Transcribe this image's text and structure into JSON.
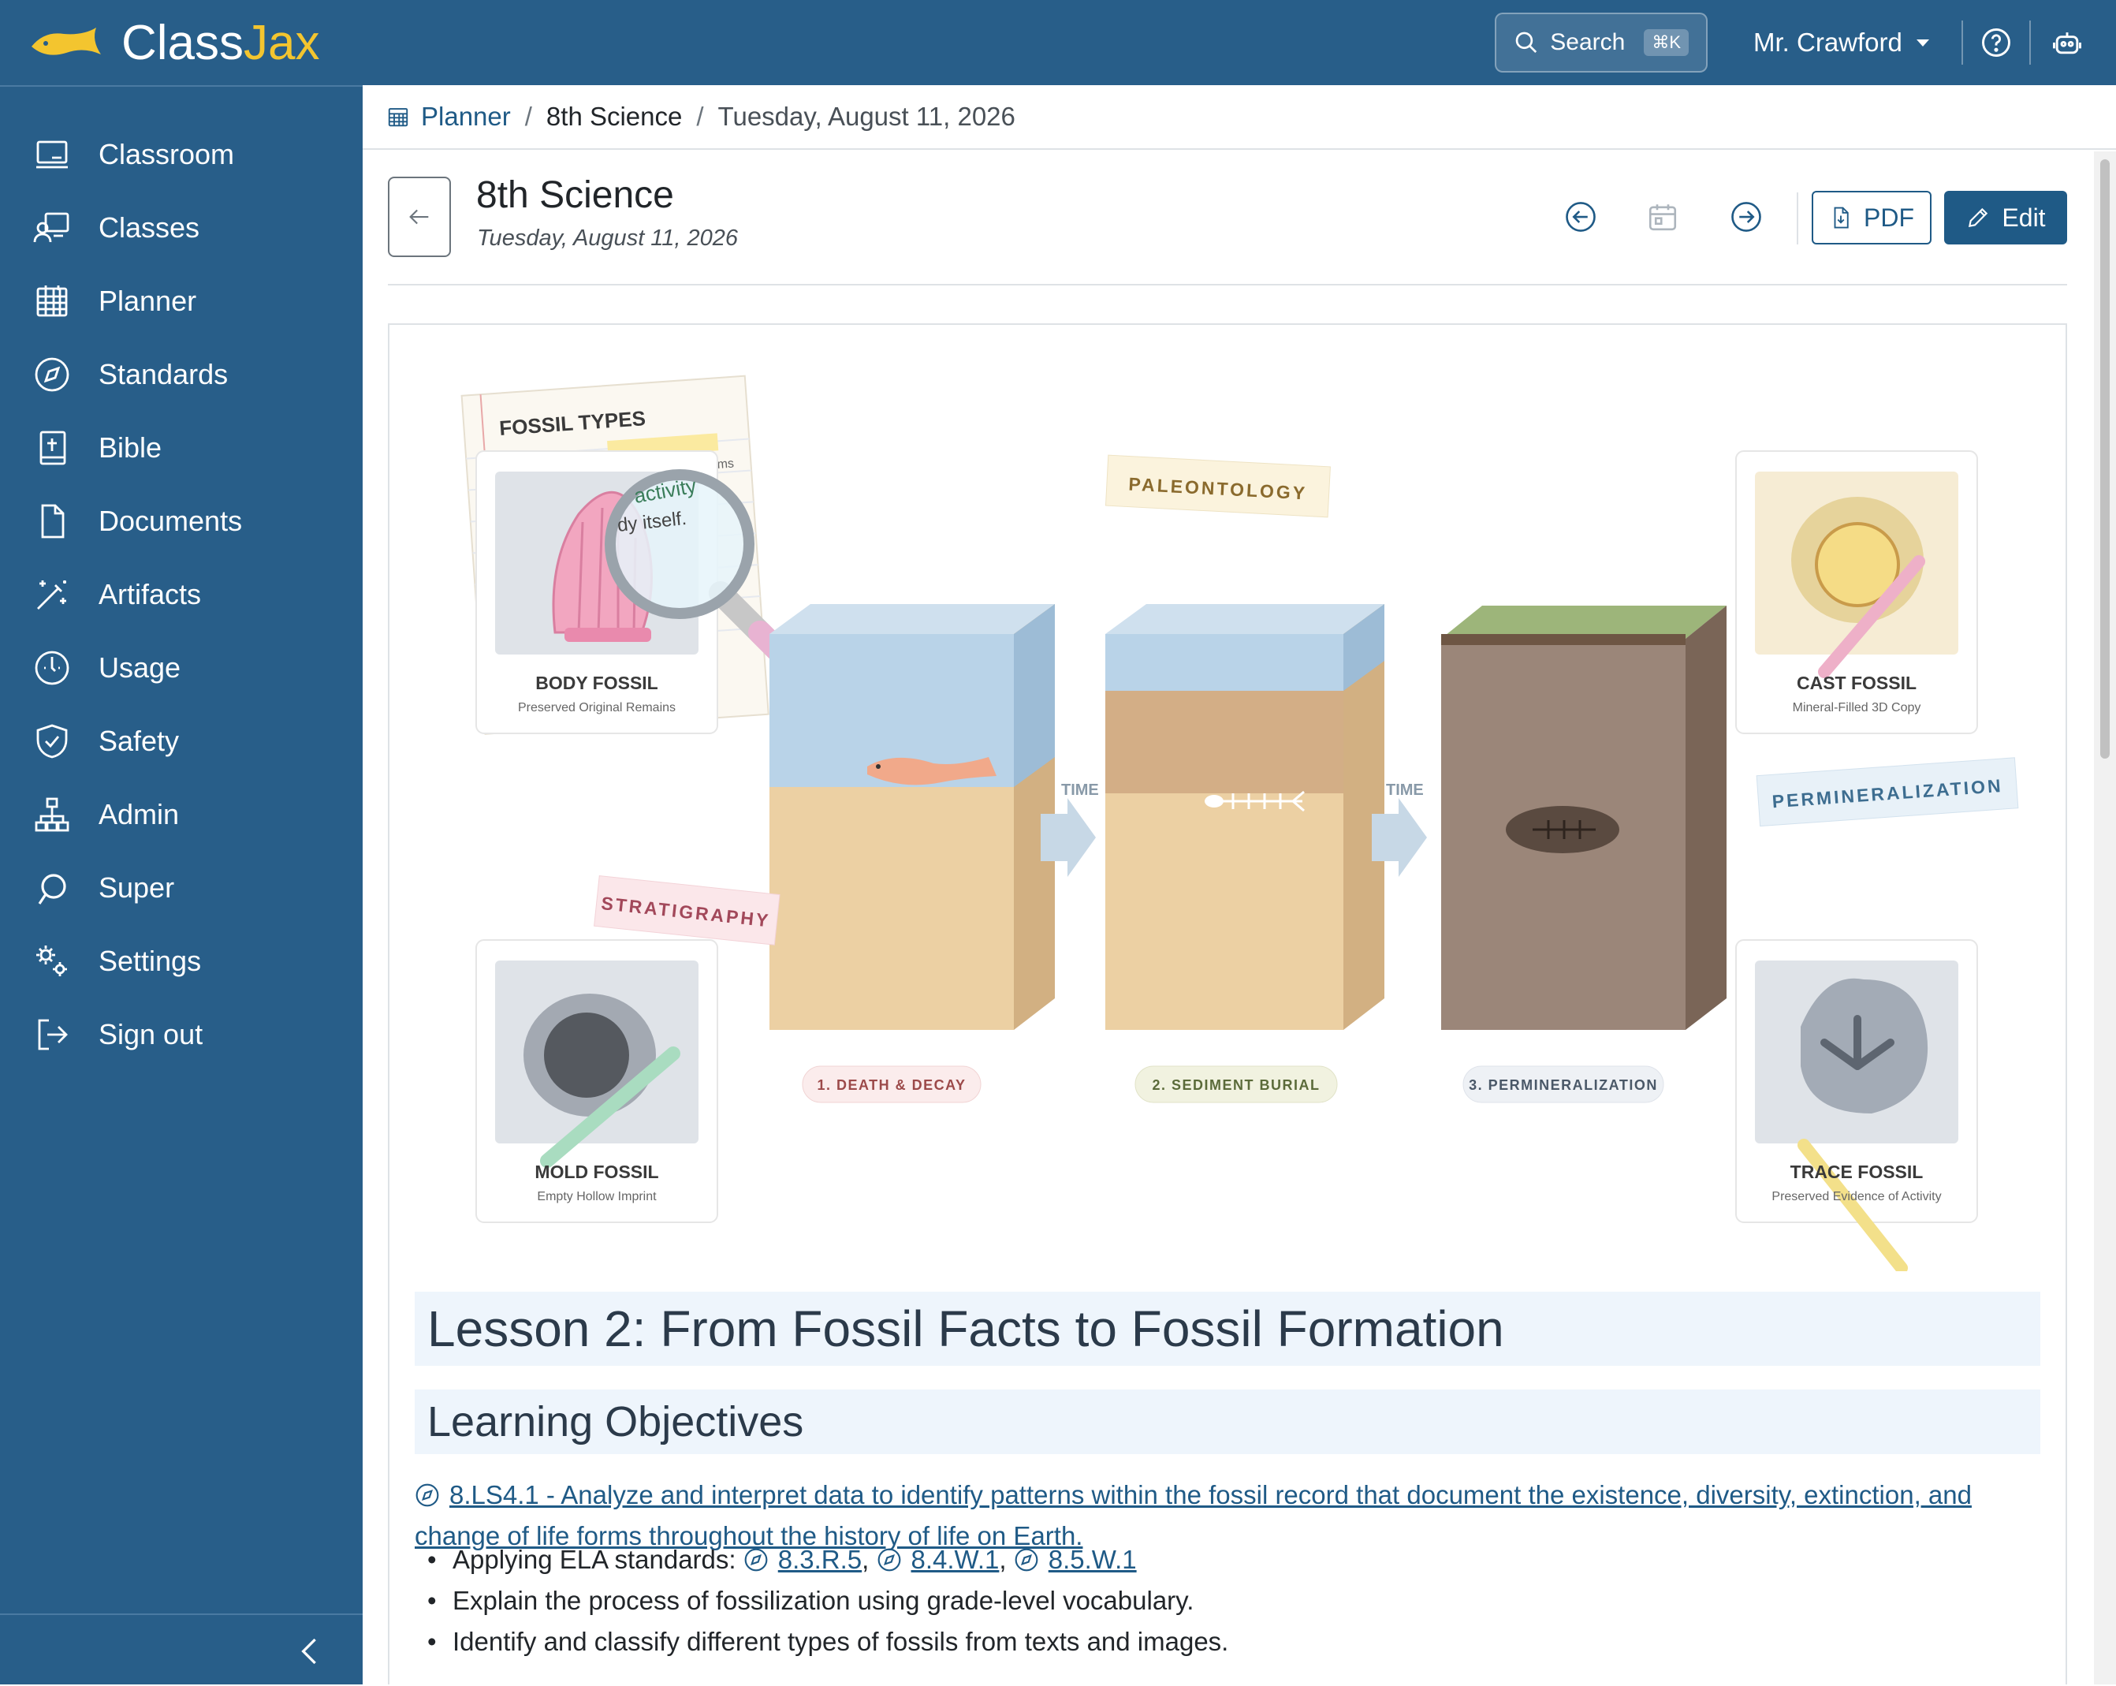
{
  "app": {
    "brand_first": "Class",
    "brand_second": "Jax"
  },
  "topbar": {
    "search_label": "Search",
    "search_shortcut": "⌘K",
    "user_name": "Mr. Crawford"
  },
  "sidebar": {
    "items": [
      {
        "label": "Classroom",
        "icon": "classroom-icon"
      },
      {
        "label": "Classes",
        "icon": "classes-icon"
      },
      {
        "label": "Planner",
        "icon": "planner-icon"
      },
      {
        "label": "Standards",
        "icon": "compass-icon"
      },
      {
        "label": "Bible",
        "icon": "bible-icon"
      },
      {
        "label": "Documents",
        "icon": "document-icon"
      },
      {
        "label": "Artifacts",
        "icon": "magic-wand-icon"
      },
      {
        "label": "Usage",
        "icon": "usage-icon"
      },
      {
        "label": "Safety",
        "icon": "shield-icon"
      },
      {
        "label": "Admin",
        "icon": "org-chart-icon"
      },
      {
        "label": "Super",
        "icon": "super-icon"
      },
      {
        "label": "Settings",
        "icon": "gears-icon"
      },
      {
        "label": "Sign out",
        "icon": "sign-out-icon"
      }
    ]
  },
  "breadcrumb": {
    "root": "Planner",
    "class": "8th Science",
    "date": "Tuesday, August 11, 2026",
    "separator": "/"
  },
  "header": {
    "title": "8th Science",
    "subtitle": "Tuesday, August 11, 2026",
    "pdf_label": "PDF",
    "edit_label": "Edit"
  },
  "illustration": {
    "notebook_title": "FOSSIL TYPES",
    "notebook_text_1": "activity",
    "notebook_text_2": "dy itself.",
    "notebook_text_3": "ms",
    "tag_paleontology": "PALEONTOLOGY",
    "tag_permineralization": "PERMINERALIZATION",
    "tag_stratigraphy": "STRATIGRAPHY",
    "time_label": "TIME",
    "cards": [
      {
        "title": "BODY FOSSIL",
        "caption": "Preserved Original Remains"
      },
      {
        "title": "CAST FOSSIL",
        "caption": "Mineral-Filled 3D Copy"
      },
      {
        "title": "MOLD FOSSIL",
        "caption": "Empty Hollow Imprint"
      },
      {
        "title": "TRACE FOSSIL",
        "caption": "Preserved Evidence of Activity"
      }
    ],
    "steps": [
      "1. DEATH & DECAY",
      "2. SEDIMENT BURIAL",
      "3. PERMINERALIZATION"
    ],
    "colors": {
      "water": "#b9d3e8",
      "sand": "#ecd0a3",
      "rock": "#9b8679",
      "grass": "#9db57a"
    }
  },
  "lesson": {
    "title": "Lesson 2: From Fossil Facts to Fossil Formation",
    "objectives_heading": "Learning Objectives",
    "standard": "8.LS4.1 - Analyze and interpret data to identify patterns within the fossil record that document the existence, diversity, extinction, and change of life forms throughout the history of life on Earth.",
    "ela_prefix": "Applying ELA standards:",
    "ela_standards": [
      "8.3.R.5",
      "8.4.W.1",
      "8.5.W.1"
    ],
    "bullet_2": "Explain the process of fossilization using grade-level vocabulary.",
    "bullet_3": "Identify and classify different types of fossils from texts and images."
  },
  "colors": {
    "brand": "#285e89",
    "accent": "#f3c52f",
    "link": "#1f5a86",
    "heading_bg": "#eef5fc"
  }
}
